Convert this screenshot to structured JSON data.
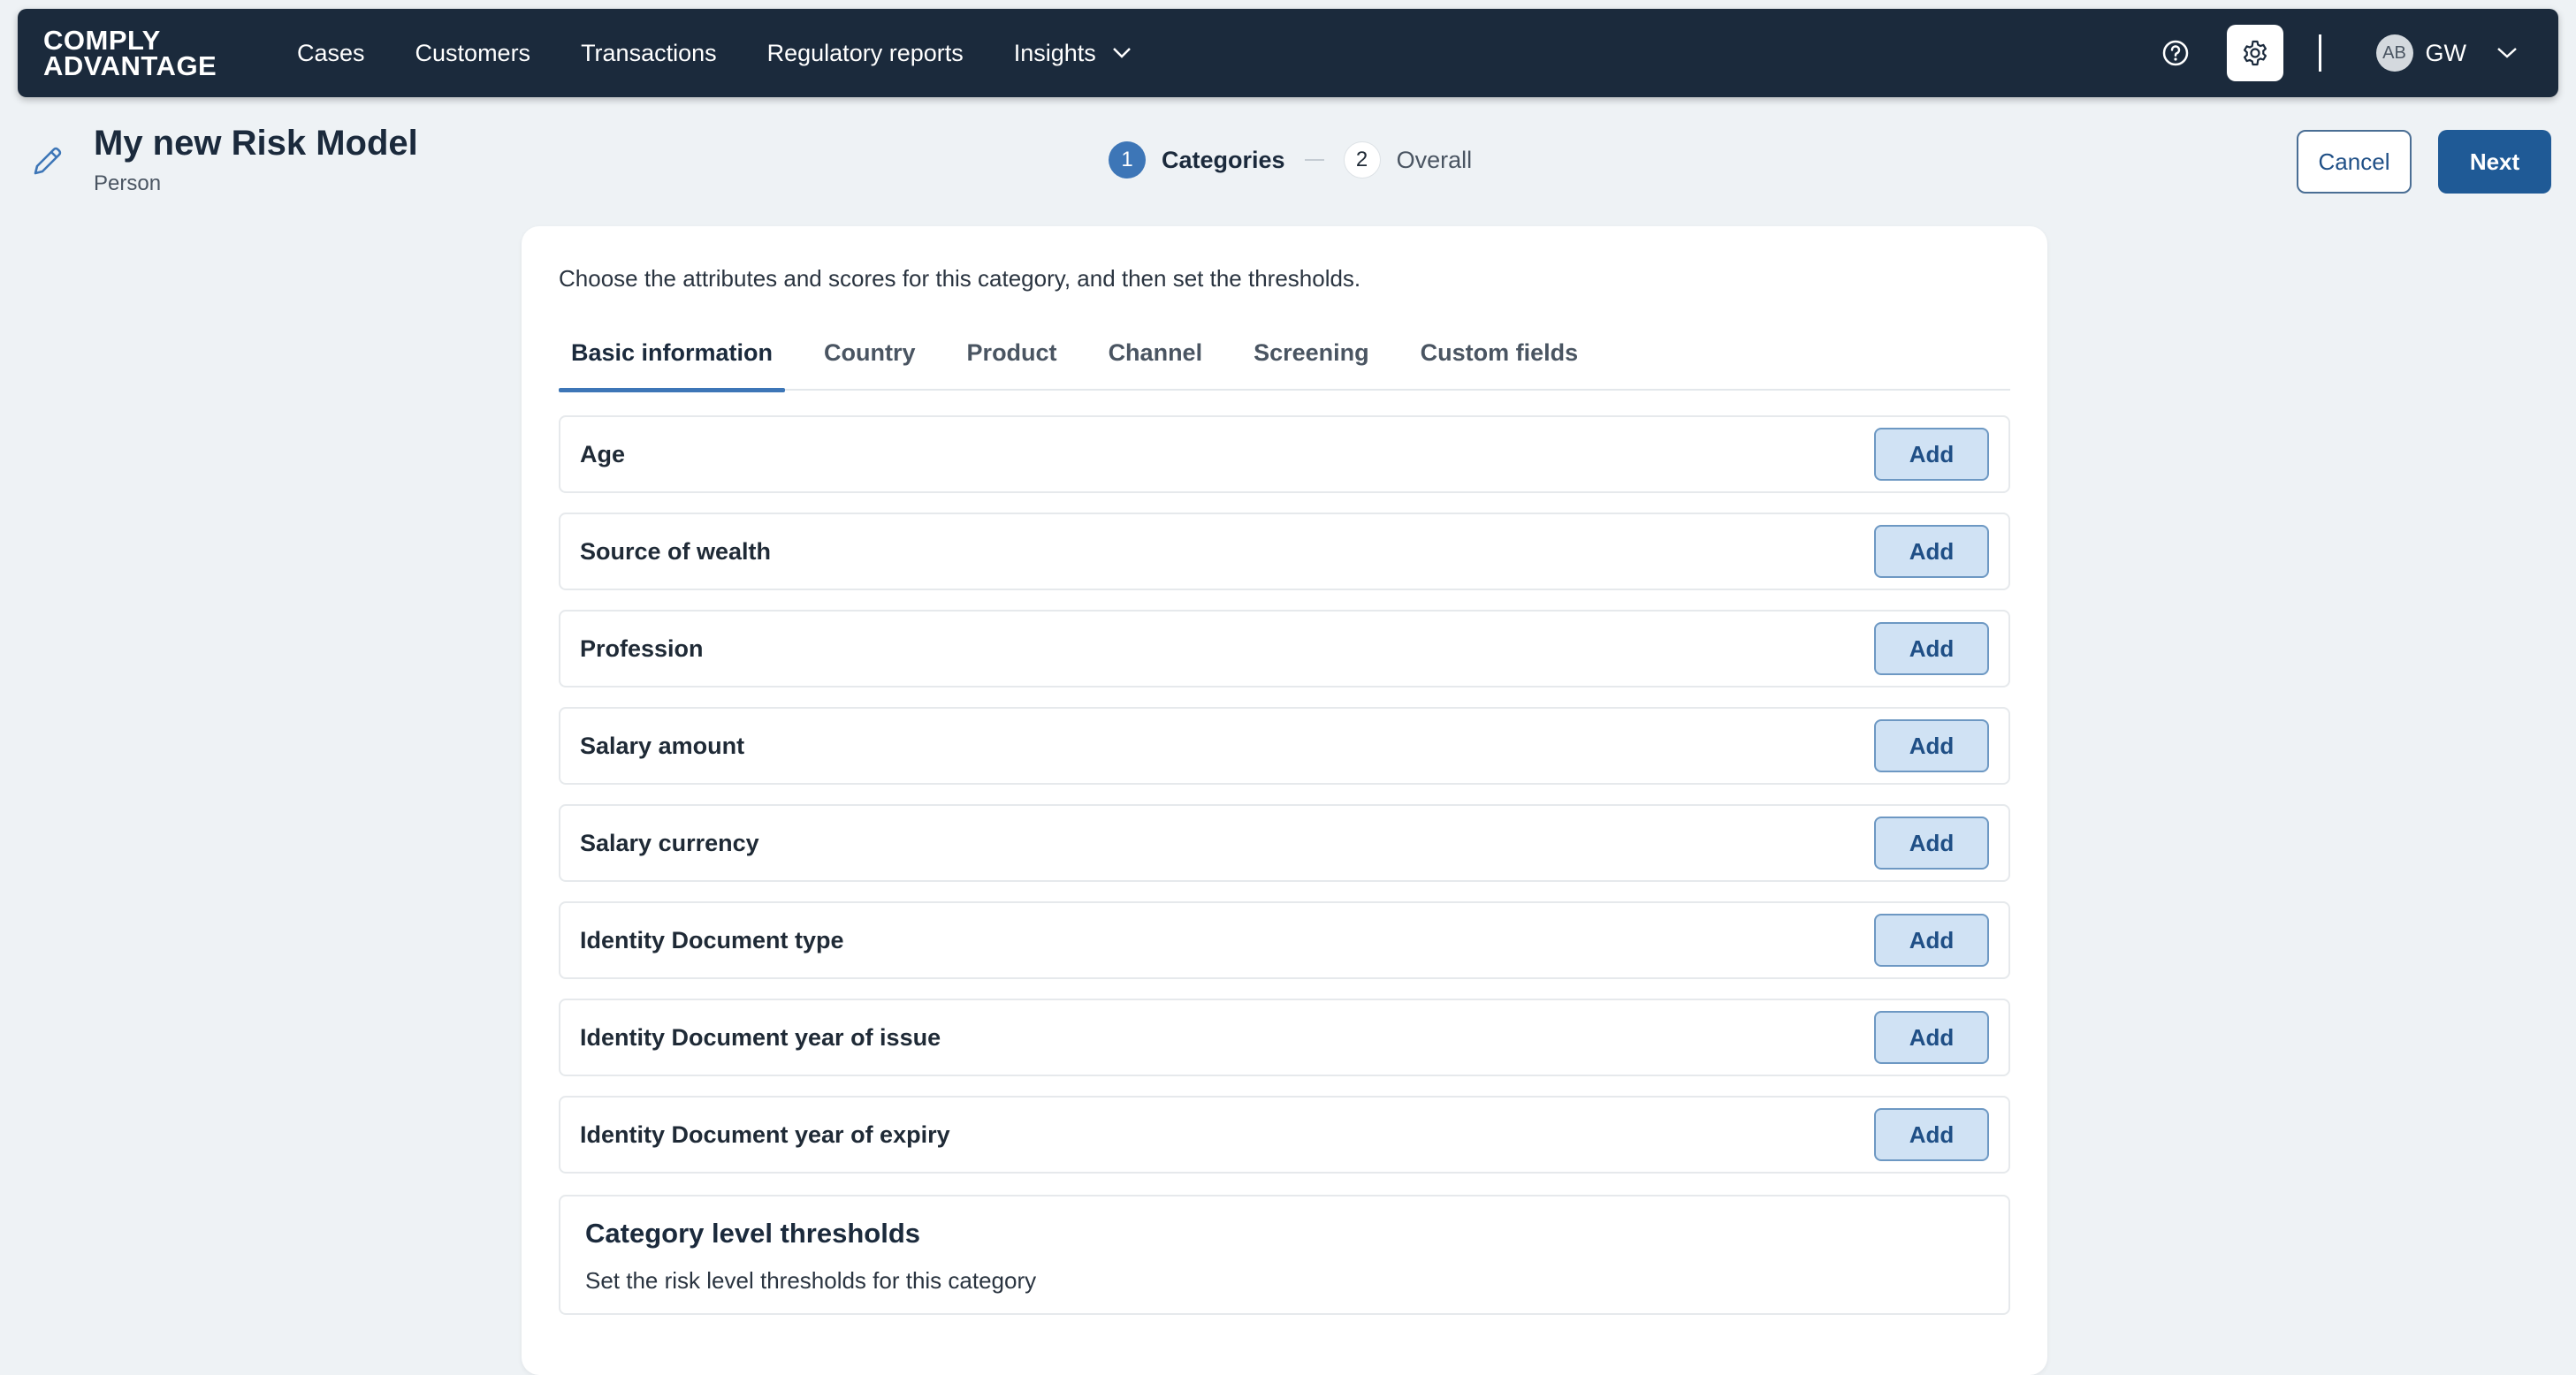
{
  "nav": {
    "logo_line1": "COMPLY",
    "logo_line2": "ADVANTAGE",
    "links": [
      "Cases",
      "Customers",
      "Transactions",
      "Regulatory reports"
    ],
    "insights_label": "Insights",
    "avatar": "AB",
    "user_initials": "GW"
  },
  "header": {
    "title": "My new Risk Model",
    "subtitle": "Person",
    "steps": [
      {
        "num": "1",
        "label": "Categories"
      },
      {
        "num": "2",
        "label": "Overall"
      }
    ],
    "cancel_label": "Cancel",
    "next_label": "Next"
  },
  "card": {
    "intro": "Choose the attributes and scores for this category, and then set the thresholds.",
    "tabs": [
      "Basic information",
      "Country",
      "Product",
      "Channel",
      "Screening",
      "Custom fields"
    ],
    "add_label": "Add",
    "attributes": [
      "Age",
      "Source of wealth",
      "Profession",
      "Salary amount",
      "Salary currency",
      "Identity Document type",
      "Identity Document year of issue",
      "Identity Document year of expiry"
    ],
    "thresholds_title": "Category level thresholds",
    "thresholds_subtitle": "Set the risk level thresholds for this category"
  },
  "colors": {
    "nav_bg": "#1b2a3c",
    "accent": "#3d76b7",
    "primary_button": "#1f5a96",
    "add_button_bg": "#d0e2f4"
  }
}
